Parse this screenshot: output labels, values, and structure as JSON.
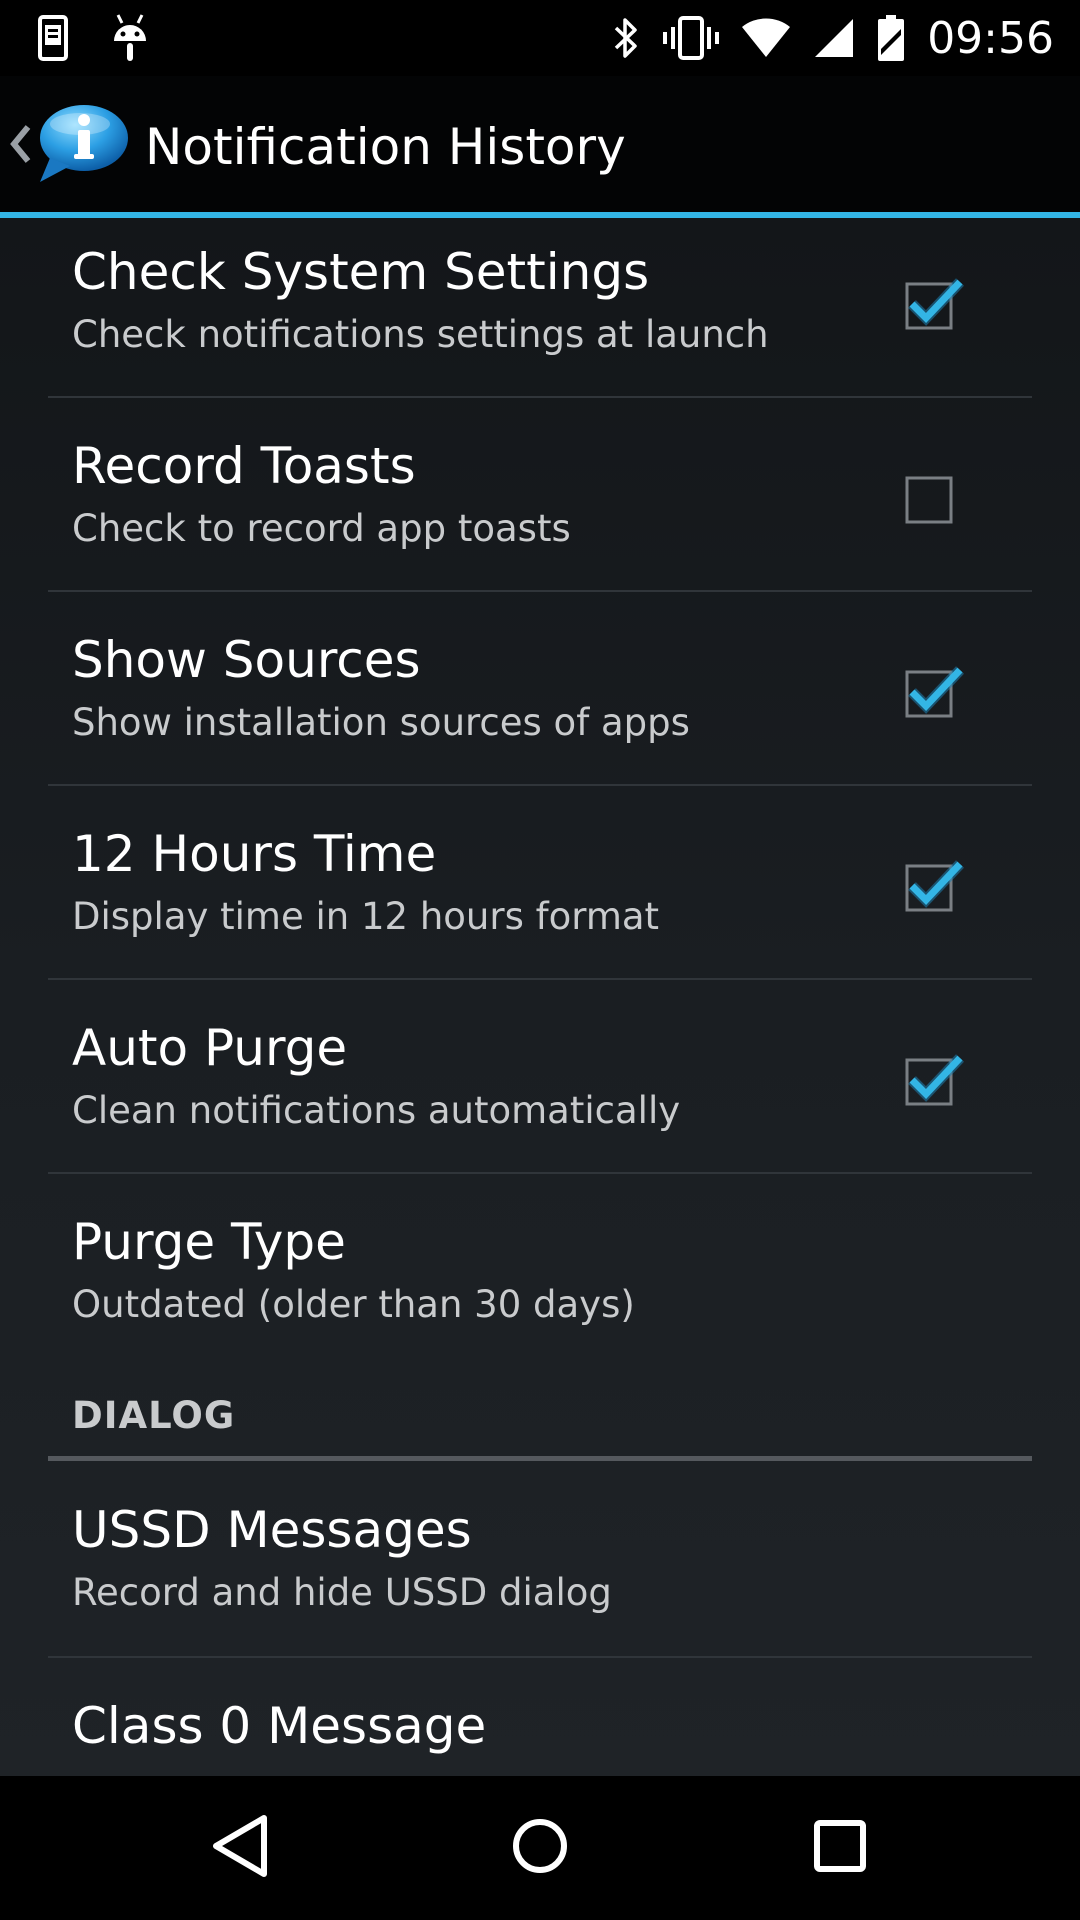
{
  "status_bar": {
    "time": "09:56",
    "left_icons": [
      "screenshot-phone-icon",
      "android-icon"
    ],
    "right_icons": [
      "bluetooth-icon",
      "vibrate-icon",
      "wifi-icon",
      "cell-signal-icon",
      "battery-icon"
    ]
  },
  "action_bar": {
    "title": "Notification History",
    "accent_color": "#33b5e5"
  },
  "preferences": [
    {
      "title": "Check System Settings",
      "summary": "Check notifications settings at launch",
      "checked": true
    },
    {
      "title": "Record Toasts",
      "summary": "Check to record app toasts",
      "checked": false
    },
    {
      "title": "Show Sources",
      "summary": "Show installation sources of apps",
      "checked": true
    },
    {
      "title": "12 Hours Time",
      "summary": "Display time in 12 hours format",
      "checked": true
    },
    {
      "title": "Auto Purge",
      "summary": "Clean notifications automatically",
      "checked": true
    },
    {
      "title": "Purge Type",
      "summary": "Outdated (older than 30 days)"
    }
  ],
  "sections": [
    {
      "header": "DIALOG",
      "items": [
        {
          "title": "USSD Messages",
          "summary": "Record and hide USSD dialog"
        },
        {
          "title": "Class 0 Message"
        }
      ]
    }
  ],
  "nav_bar": {
    "icons": [
      "back-icon",
      "home-icon",
      "recents-icon"
    ]
  }
}
